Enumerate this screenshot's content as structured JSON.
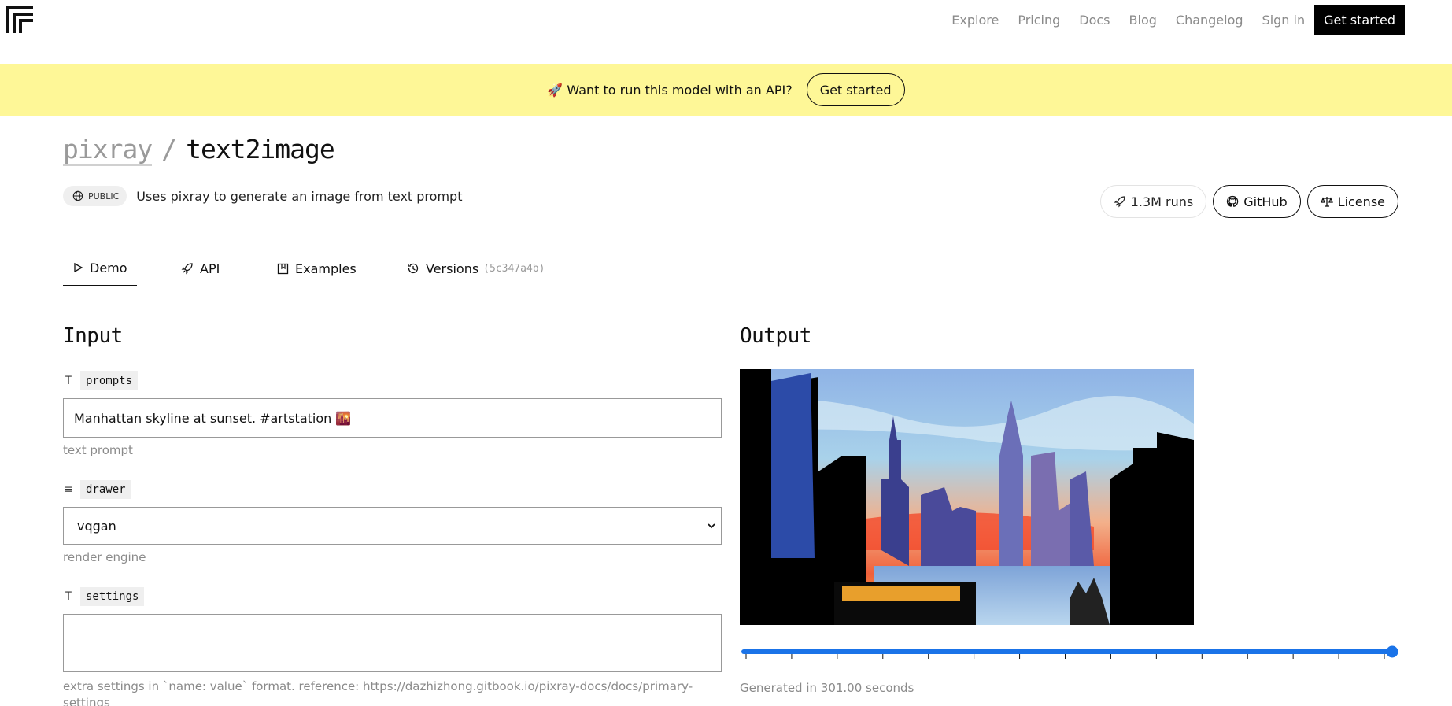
{
  "nav": {
    "links": [
      "Explore",
      "Pricing",
      "Docs",
      "Blog",
      "Changelog",
      "Sign in"
    ],
    "cta": "Get started"
  },
  "banner": {
    "text": "🚀 Want to run this model with an API?",
    "button": "Get started"
  },
  "header": {
    "owner": "pixray",
    "separator": "/",
    "model": "text2image",
    "visibility": "PUBLIC",
    "description": "Uses pixray to generate an image from text prompt",
    "runs": "1.3M runs",
    "github": "GitHub",
    "license": "License"
  },
  "tabs": {
    "demo": "Demo",
    "api": "API",
    "examples": "Examples",
    "versions": "Versions",
    "version_hash": "(5c347a4b)"
  },
  "input": {
    "heading": "Input",
    "fields": [
      {
        "type_icon": "T",
        "name": "prompts",
        "value": "Manhattan skyline at sunset. #artstation 🌇",
        "hint": "text prompt"
      },
      {
        "type_icon": "≡",
        "name": "drawer",
        "value": "vqgan",
        "hint": "render engine"
      },
      {
        "type_icon": "T",
        "name": "settings",
        "value": "",
        "hint": "extra settings in `name: value` format. reference: https://dazhizhong.gitbook.io/pixray-docs/docs/primary-settings"
      }
    ]
  },
  "output": {
    "heading": "Output",
    "slider_position": 1.0,
    "slider_ticks": 15,
    "generated": "Generated in 301.00 seconds"
  },
  "colors": {
    "banner_bg": "#fef797",
    "slider_accent": "#1a73e8"
  }
}
